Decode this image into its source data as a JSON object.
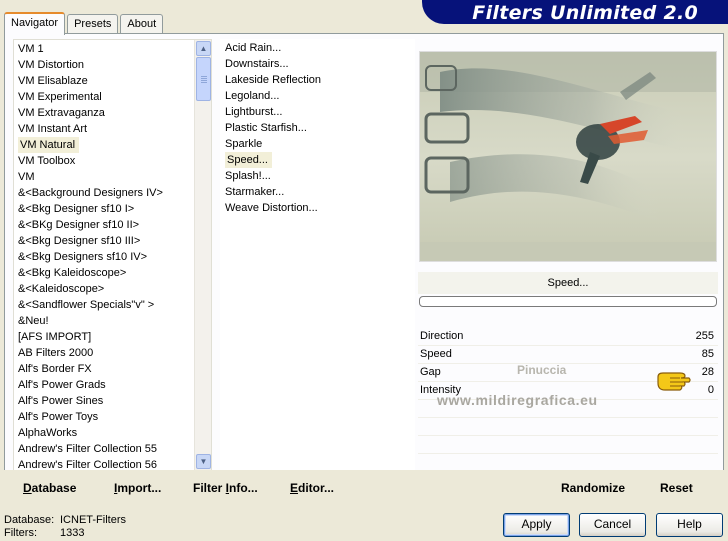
{
  "banner": {
    "title": "Filters Unlimited 2.0"
  },
  "tabs": [
    "Navigator",
    "Presets",
    "About"
  ],
  "categories": [
    "VM 1",
    "VM Distortion",
    "VM Elisablaze",
    "VM Experimental",
    "VM Extravaganza",
    "VM Instant Art",
    "VM Natural",
    "VM Toolbox",
    "VM",
    "&<Background Designers IV>",
    "&<Bkg Designer sf10 I>",
    "&<BKg Designer sf10 II>",
    "&<Bkg Designer sf10 III>",
    "&<Bkg Designers sf10 IV>",
    "&<Bkg Kaleidoscope>",
    "&<Kaleidoscope>",
    "&<Sandflower Specials\"v\" >",
    "&Neu!",
    "[AFS IMPORT]",
    "AB Filters 2000",
    "Alf's Border FX",
    "Alf's Power Grads",
    "Alf's Power Sines",
    "Alf's Power Toys",
    "AlphaWorks",
    "Andrew's Filter Collection 55",
    "Andrew's Filter Collection 56"
  ],
  "selected_category": "VM Natural",
  "filters": [
    "Acid Rain...",
    "Downstairs...",
    "Lakeside Reflection",
    "Legoland...",
    "Lightburst...",
    "Plastic Starfish...",
    "Sparkle",
    "Speed...",
    "Splash!...",
    "Starmaker...",
    "Weave Distortion..."
  ],
  "selected_filter": "Speed...",
  "preview": {
    "filter_title": "Speed...",
    "progress": 0
  },
  "params": [
    {
      "name": "Direction",
      "value": "255"
    },
    {
      "name": "Speed",
      "value": "85"
    },
    {
      "name": "Gap",
      "value": "28"
    },
    {
      "name": "Intensity",
      "value": "0"
    }
  ],
  "watermark": {
    "line1": "Pinuccia",
    "line2": "www.mildiregrafica.eu"
  },
  "strip_buttons": {
    "database": {
      "ul": "D",
      "rest": "atabase"
    },
    "import": {
      "ul": "I",
      "rest": "mport..."
    },
    "filter_info": {
      "pre": "Filter ",
      "ul": "I",
      "rest": "nfo..."
    },
    "editor": {
      "ul": "E",
      "rest": "ditor..."
    },
    "randomize": "Randomize",
    "reset": "Reset"
  },
  "info": {
    "database_label": "Database:",
    "database_value": "ICNET-Filters",
    "filters_label": "Filters:",
    "filters_value": "1333"
  },
  "dialog_buttons": {
    "apply": "Apply",
    "cancel": "Cancel",
    "help": "Help"
  },
  "colors": {
    "banner": "#06127a",
    "panel": "#ece9d8",
    "selection": "#f2efd8"
  },
  "icons": [
    "pointing-hand-icon",
    "scroll-up-icon",
    "scroll-down-icon"
  ]
}
